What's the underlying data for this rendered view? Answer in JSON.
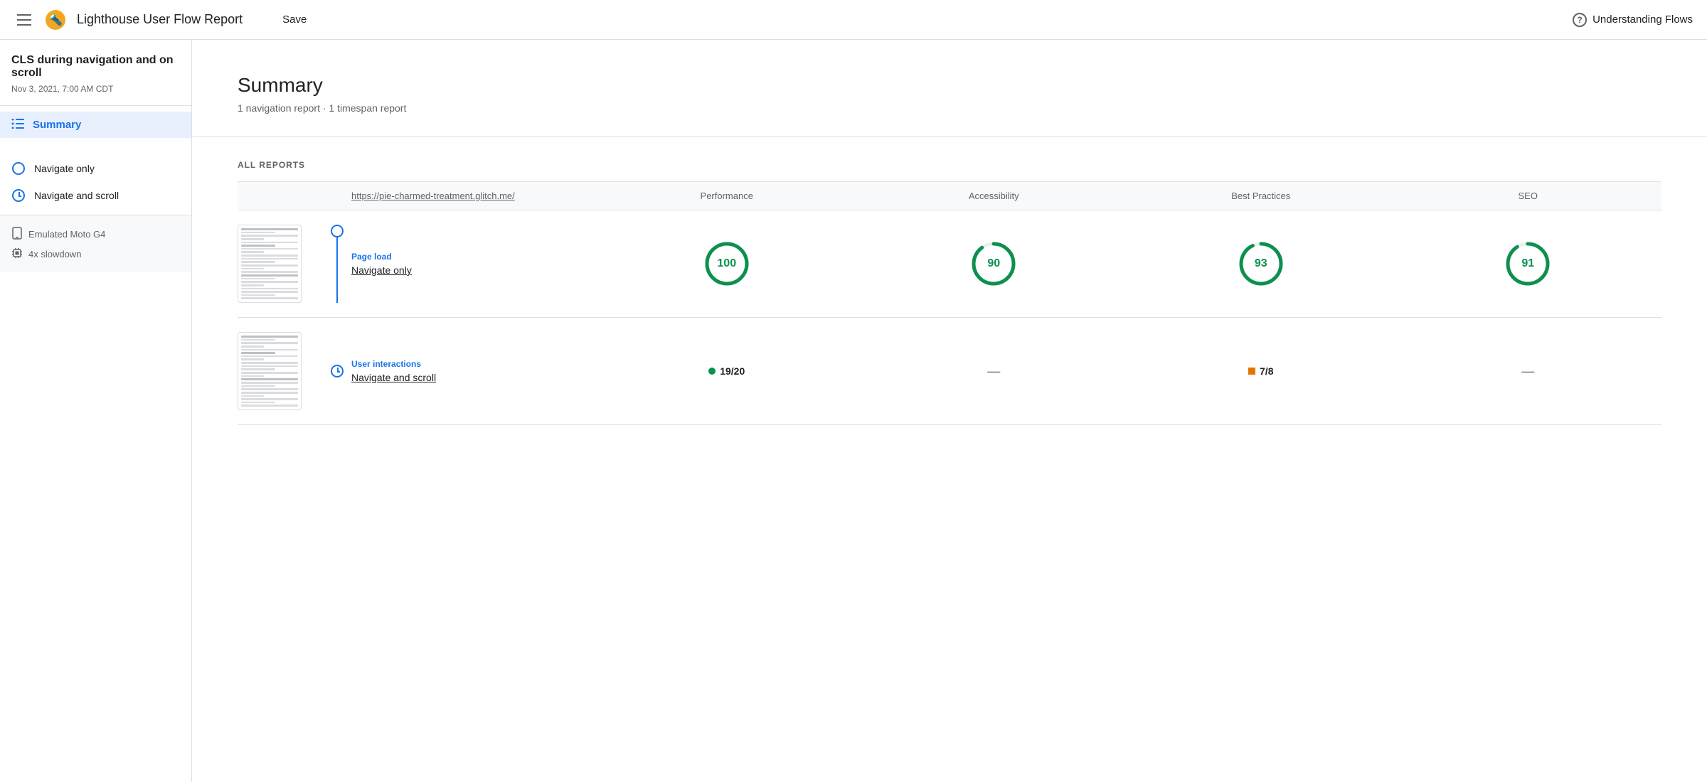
{
  "header": {
    "menu_icon": "hamburger",
    "logo": "🔦",
    "title": "Lighthouse User Flow Report",
    "save_label": "Save",
    "help_icon": "?",
    "understanding_flows_label": "Understanding Flows"
  },
  "sidebar": {
    "project_title": "CLS during navigation and on scroll",
    "project_date": "Nov 3, 2021, 7:00 AM CDT",
    "summary_label": "Summary",
    "flow_items": [
      {
        "label": "Navigate only",
        "type": "nav"
      },
      {
        "label": "Navigate and scroll",
        "type": "clock"
      }
    ],
    "device_items": [
      {
        "icon": "📱",
        "label": "Emulated Moto G4"
      },
      {
        "icon": "⚙",
        "label": "4x slowdown"
      }
    ]
  },
  "main": {
    "summary_heading": "Summary",
    "summary_sub": "1 navigation report · 1 timespan report",
    "all_reports_label": "ALL REPORTS",
    "table_headers": {
      "url": "https://pie-charmed-treatment.glitch.me/",
      "performance": "Performance",
      "accessibility": "Accessibility",
      "best_practices": "Best Practices",
      "seo": "SEO"
    },
    "rows": [
      {
        "type_label": "Page load",
        "name": "Navigate only",
        "connector_type": "nav",
        "performance": 100,
        "accessibility": 90,
        "best_practices": 93,
        "seo": 91,
        "score_type": "gauge"
      },
      {
        "type_label": "User interactions",
        "name": "Navigate and scroll",
        "connector_type": "clock",
        "performance_ts": "19/20",
        "accessibility_ts": "—",
        "best_practices_ts": "7/8",
        "seo_ts": "—",
        "score_type": "timespan"
      }
    ]
  }
}
